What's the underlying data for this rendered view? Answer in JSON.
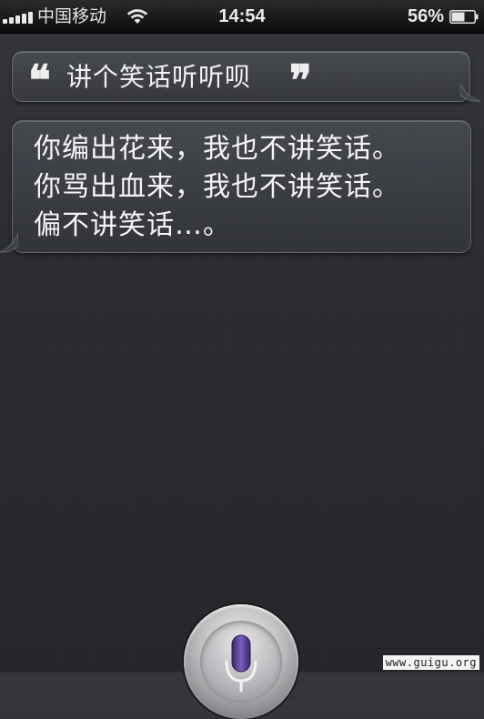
{
  "status_bar": {
    "carrier": "中国移动",
    "time": "14:54",
    "battery_percent": "56%",
    "signal_icon": "signal-bars-icon",
    "wifi_icon": "wifi-icon",
    "battery_icon": "battery-icon"
  },
  "query": {
    "open_quote": "❝",
    "text": "讲个笑话听听呗",
    "close_quote": "❞"
  },
  "answer": {
    "lines": [
      "你编出花来，我也不讲笑话。",
      "你骂出血来，我也不讲笑话。",
      "偏不讲笑话…。"
    ]
  },
  "mic": {
    "icon": "microphone-icon",
    "accent_color": "#6b4fa8"
  },
  "watermark": "www.guigu.org"
}
